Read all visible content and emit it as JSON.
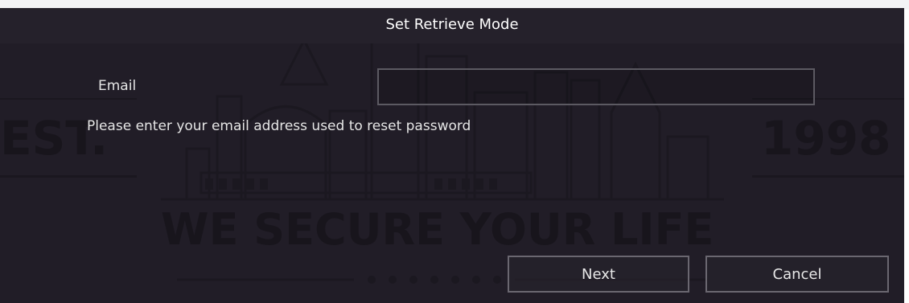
{
  "dialog": {
    "title": "Set Retrieve Mode",
    "email_label": "Email",
    "email_value": "",
    "hint": "Please enter your email address used to reset password",
    "next_label": "Next",
    "cancel_label": "Cancel"
  },
  "background": {
    "left_text": "EST.",
    "right_text": "1998",
    "slogan": "WE SECURE YOUR LIFE"
  }
}
